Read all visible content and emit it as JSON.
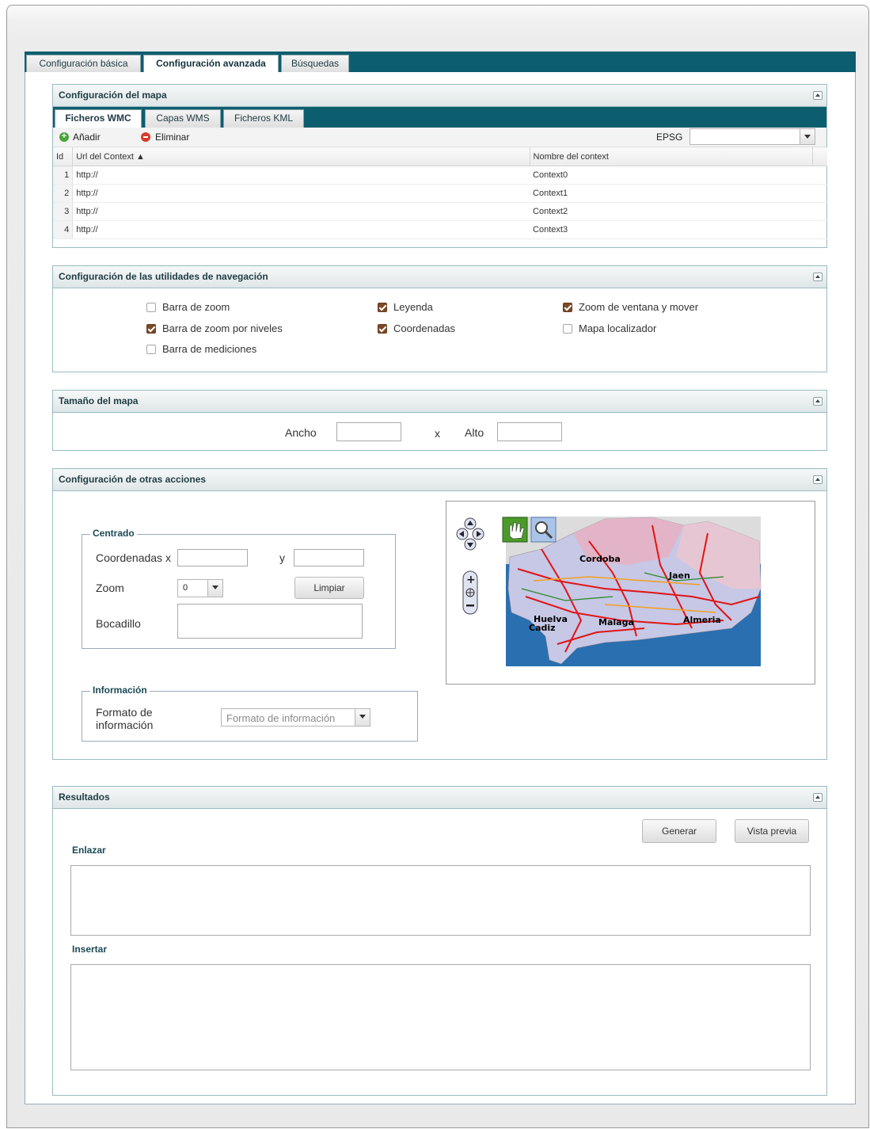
{
  "main_tabs": [
    "Configuración básica",
    "Configuración avanzada",
    "Búsquedas"
  ],
  "map_config": {
    "title": "Configuración del mapa",
    "subtabs": [
      "Ficheros WMC",
      "Capas WMS",
      "Ficheros KML"
    ],
    "add_label": "Añadir",
    "delete_label": "Eliminar",
    "epsg_label": "EPSG",
    "epsg_value": "",
    "columns": {
      "id": "Id",
      "url": "Url del Context ▲",
      "name": "Nombre del context"
    },
    "rows": [
      {
        "id": "1",
        "url": "http://",
        "name": "Context0"
      },
      {
        "id": "2",
        "url": "http://",
        "name": "Context1"
      },
      {
        "id": "3",
        "url": "http://",
        "name": "Context2"
      },
      {
        "id": "4",
        "url": "http://",
        "name": "Context3"
      }
    ]
  },
  "nav_config": {
    "title": "Configuración de las utilidades de navegación",
    "options": [
      {
        "label": "Barra de zoom",
        "checked": false
      },
      {
        "label": "Barra de zoom por niveles",
        "checked": true
      },
      {
        "label": "Barra de mediciones",
        "checked": false
      },
      {
        "label": "Leyenda",
        "checked": true
      },
      {
        "label": "Coordenadas",
        "checked": true
      },
      {
        "label": "Zoom de ventana y mover",
        "checked": true
      },
      {
        "label": "Mapa localizador",
        "checked": false
      }
    ]
  },
  "map_size": {
    "title": "Tamaño del mapa",
    "width_label": "Ancho",
    "x_label": "x",
    "height_label": "Alto",
    "width_value": "",
    "height_value": ""
  },
  "other_actions": {
    "title": "Configuración de otras acciones",
    "centrado": {
      "legend": "Centrado",
      "coord_x_label": "Coordenadas x",
      "y_label": "y",
      "zoom_label": "Zoom",
      "zoom_value": "0",
      "clear_button": "Limpiar",
      "bocadillo_label": "Bocadillo"
    },
    "informacion": {
      "legend": "Información",
      "format_label": "Formato de información",
      "format_placeholder": "Formato de información"
    },
    "map_labels": [
      "Cordoba",
      "Jaen",
      "Huelva",
      "Malaga",
      "Almeria",
      "Cadiz"
    ]
  },
  "results": {
    "title": "Resultados",
    "generate_button": "Generar",
    "preview_button": "Vista previa",
    "link_label": "Enlazar",
    "insert_label": "Insertar"
  }
}
